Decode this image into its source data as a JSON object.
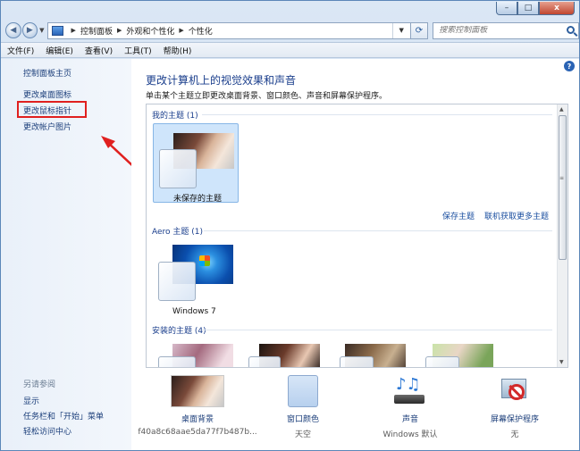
{
  "window": {
    "controls": {
      "minimize": "–",
      "maximize": "□",
      "close": "x"
    }
  },
  "nav": {
    "back_icon": "back-arrow-icon",
    "forward_icon": "forward-arrow-icon"
  },
  "address": {
    "crumbs": [
      "控制面板",
      "外观和个性化",
      "个性化"
    ]
  },
  "search": {
    "placeholder": "搜索控制面板"
  },
  "menu": [
    {
      "label": "文件(F)"
    },
    {
      "label": "编辑(E)"
    },
    {
      "label": "查看(V)"
    },
    {
      "label": "工具(T)"
    },
    {
      "label": "帮助(H)"
    }
  ],
  "sidebar": {
    "links": [
      "控制面板主页",
      "更改桌面图标",
      "更改鼠标指针",
      "更改帐户图片"
    ],
    "see_also_title": "另请参阅",
    "see_also": [
      "显示",
      "任务栏和「开始」菜单",
      "轻松访问中心"
    ]
  },
  "main": {
    "title": "更改计算机上的视觉效果和声音",
    "subtitle": "单击某个主题立即更改桌面背景、窗口颜色、声音和屏幕保护程序。",
    "groups": {
      "my_themes": "我的主题 (1)",
      "aero_themes": "Aero 主题 (1)",
      "installed_themes": "安装的主题 (4)"
    },
    "themes": {
      "unsaved": "未保存的主题",
      "windows7": "Windows 7"
    },
    "links": {
      "save_theme": "保存主题",
      "get_more": "联机获取更多主题"
    }
  },
  "bottom": {
    "desktop_bg": {
      "label": "桌面背景",
      "value": "f40a8c68aae5da77f7b487b..."
    },
    "window_color": {
      "label": "窗口颜色",
      "value": "天空"
    },
    "sound": {
      "label": "声音",
      "value": "Windows 默认"
    },
    "screensaver": {
      "label": "屏幕保护程序",
      "value": "无"
    }
  },
  "colors": {
    "link": "#1b3e7a",
    "title": "#1a3e8c",
    "annotation": "#e0201f",
    "selection": "#cfe5fb"
  }
}
